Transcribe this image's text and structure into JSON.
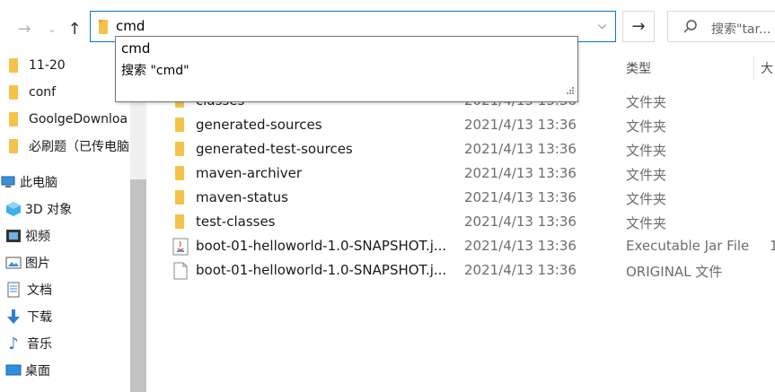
{
  "address_bar": {
    "value": "cmd"
  },
  "search": {
    "placeholder": "搜索\"tar..."
  },
  "autocomplete": {
    "items": [
      "cmd",
      "搜索 \"cmd\""
    ]
  },
  "columns": {
    "type": "类型",
    "size": "大"
  },
  "sidebar": {
    "items": [
      {
        "label": "11-20",
        "icon": "folder-icon"
      },
      {
        "label": "conf",
        "icon": "folder-icon"
      },
      {
        "label": "GoolgeDownloa",
        "icon": "folder-icon"
      },
      {
        "label": "必刷题（已传电脑",
        "icon": "folder-icon"
      },
      {
        "label": "此电脑",
        "icon": "computer-icon"
      },
      {
        "label": "3D 对象",
        "icon": "3d-objects-icon"
      },
      {
        "label": "视频",
        "icon": "videos-icon"
      },
      {
        "label": "图片",
        "icon": "pictures-icon"
      },
      {
        "label": "文档",
        "icon": "documents-icon"
      },
      {
        "label": "下载",
        "icon": "downloads-icon"
      },
      {
        "label": "音乐",
        "icon": "music-icon"
      },
      {
        "label": "桌面",
        "icon": "desktop-icon"
      }
    ]
  },
  "files": [
    {
      "name": "classes",
      "date": "2021/4/13 13:36",
      "type": "文件夹",
      "size": "",
      "icon": "folder-icon"
    },
    {
      "name": "generated-sources",
      "date": "2021/4/13 13:36",
      "type": "文件夹",
      "size": "",
      "icon": "folder-icon"
    },
    {
      "name": "generated-test-sources",
      "date": "2021/4/13 13:36",
      "type": "文件夹",
      "size": "",
      "icon": "folder-icon"
    },
    {
      "name": "maven-archiver",
      "date": "2021/4/13 13:36",
      "type": "文件夹",
      "size": "",
      "icon": "folder-icon"
    },
    {
      "name": "maven-status",
      "date": "2021/4/13 13:36",
      "type": "文件夹",
      "size": "",
      "icon": "folder-icon"
    },
    {
      "name": "test-classes",
      "date": "2021/4/13 13:36",
      "type": "文件夹",
      "size": "",
      "icon": "folder-icon"
    },
    {
      "name": "boot-01-helloworld-1.0-SNAPSHOT.j...",
      "date": "2021/4/13 13:36",
      "type": "Executable Jar File",
      "size": "1",
      "icon": "java-jar-icon"
    },
    {
      "name": "boot-01-helloworld-1.0-SNAPSHOT.j...",
      "date": "2021/4/13 13:36",
      "type": "ORIGINAL 文件",
      "size": "",
      "icon": "file-icon"
    }
  ],
  "colors": {
    "accent": "#0078d7",
    "folder": "#f4c34a"
  }
}
